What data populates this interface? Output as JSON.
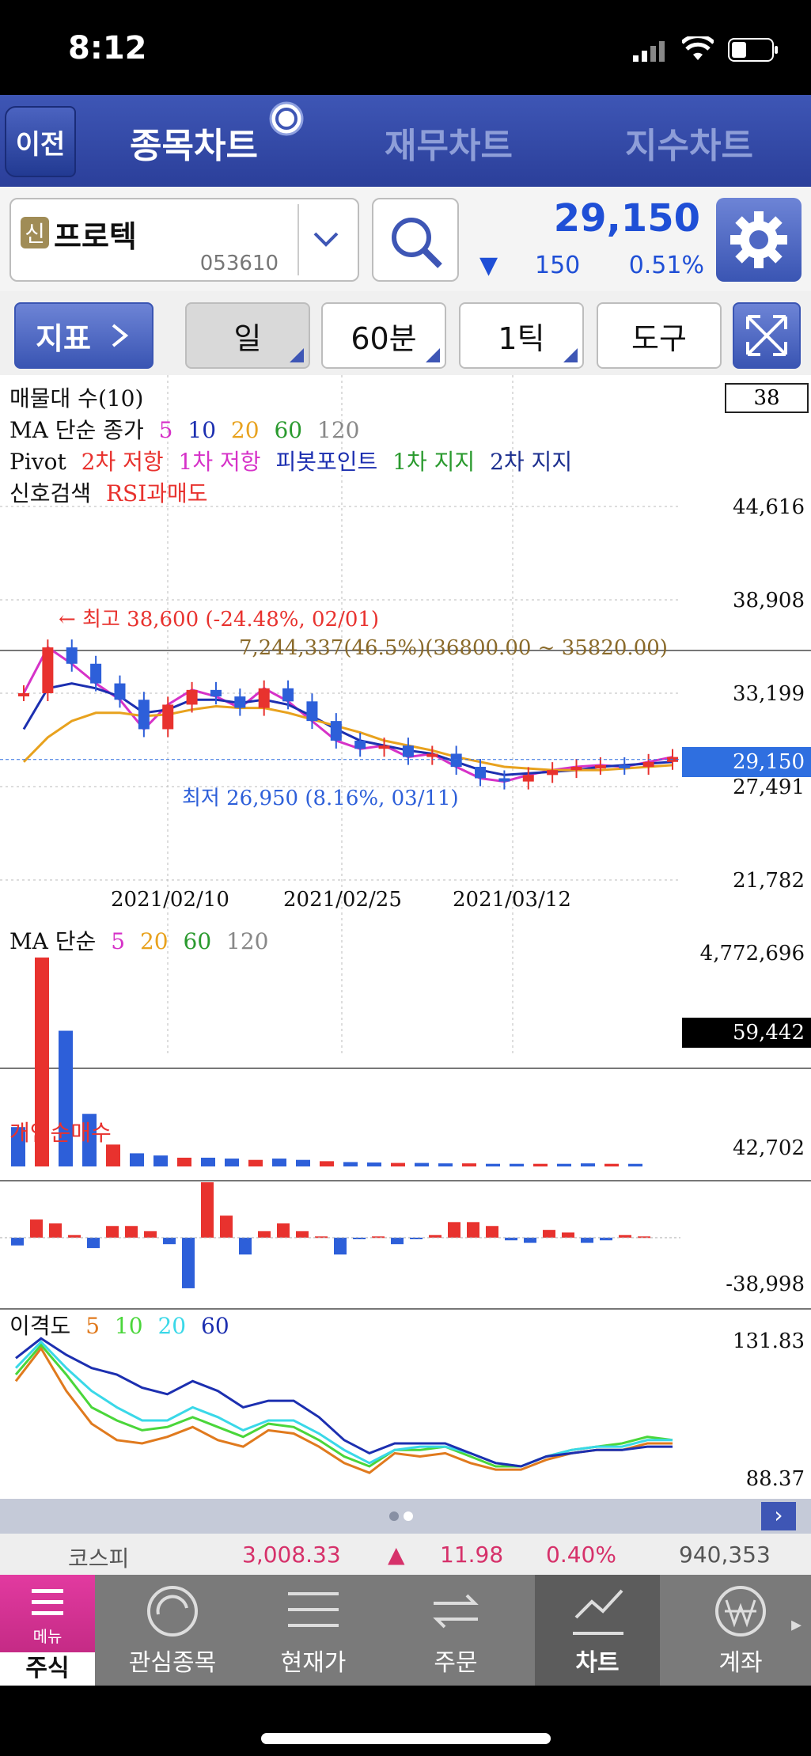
{
  "status_bar": {
    "time": "8:12"
  },
  "tabs": {
    "back": "이전",
    "items": [
      "종목차트",
      "재무차트",
      "지수차트"
    ]
  },
  "stock": {
    "badge": "신",
    "name": "프로텍",
    "code": "053610",
    "price": "29,150",
    "change_arrow": "▼",
    "change": "150",
    "change_pct": "0.51%"
  },
  "toolbar": {
    "indicator": "지표",
    "period": "일",
    "minute": "60분",
    "tick": "1틱",
    "tools": "도구"
  },
  "main_chart": {
    "legend": {
      "line1": "매물대 수(10)",
      "line2_prefix": "MA 단순 종가",
      "ma_periods": [
        "5",
        "10",
        "20",
        "60",
        "120"
      ],
      "line3_prefix": "Pivot",
      "pivot": [
        "2차 저항",
        "1차 저항",
        "피봇포인트",
        "1차 지지",
        "2차 지지"
      ],
      "line4_prefix": "신호검색",
      "signal": "RSI과매도"
    },
    "box_value": "38",
    "y_ticks": [
      "44,616",
      "38,908",
      "33,199",
      "27,491",
      "21,782"
    ],
    "current_price": "29,150",
    "high_annotation": "← 최고 38,600 (-24.48%, 02/01)",
    "low_annotation": "최저 26,950 (8.16%, 03/11)",
    "volume_profile_annotation": "7,244,337(46.5%)(36800.00 ~ 35820.00)",
    "x_ticks": [
      "2021/02/10",
      "2021/02/25",
      "2021/03/12"
    ]
  },
  "volume_chart": {
    "legend_prefix": "MA 단순",
    "ma_periods": [
      "5",
      "20",
      "60",
      "120"
    ],
    "y_top": "4,772,696",
    "current": "59,442"
  },
  "net_buy_chart": {
    "title": "개인순매수",
    "y_top": "42,702",
    "y_bottom": "-38,998"
  },
  "disparity_chart": {
    "title": "이격도",
    "periods": [
      "5",
      "10",
      "20",
      "60"
    ],
    "y_top": "131.83",
    "y_bottom": "88.37"
  },
  "index_ticker": {
    "name": "코스피",
    "value": "3,008.33",
    "arrow": "▲",
    "change": "11.98",
    "pct": "0.40%",
    "volume": "940,353"
  },
  "bottom_nav": {
    "menu": "메뉴",
    "items": [
      "주식",
      "관심종목",
      "현재가",
      "주문",
      "차트",
      "계좌"
    ]
  },
  "colors": {
    "up": "#e8322e",
    "down": "#2d5fd9",
    "ma5": "#d632c8",
    "ma10": "#1c2fb0",
    "ma20": "#e8a21e",
    "ma60": "#2a9a2e",
    "ma120": "#888888"
  },
  "chart_data": [
    {
      "type": "line",
      "title": "",
      "x_ticks": [
        "2021/02/10",
        "2021/02/25",
        "2021/03/12"
      ],
      "ylim": [
        21782,
        44616
      ],
      "series": [
        {
          "name": "5",
          "values": [
            33200,
            36000,
            35000,
            33800,
            32800,
            31000,
            32500,
            33400,
            33000,
            32300,
            33500,
            32700,
            31500,
            30300,
            29800,
            30000,
            29300,
            29500,
            28700,
            28000,
            27800,
            28200,
            28500,
            28700,
            28800,
            28700,
            29000,
            29300
          ]
        },
        {
          "name": "10",
          "values": [
            31000,
            33500,
            33800,
            33500,
            33000,
            32000,
            32200,
            32800,
            32800,
            32600,
            32800,
            32500,
            31800,
            31000,
            30300,
            30000,
            29700,
            29500,
            29000,
            28500,
            28200,
            28300,
            28400,
            28500,
            28700,
            28800,
            28900,
            29000
          ]
        },
        {
          "name": "20",
          "values": [
            29000,
            30500,
            31500,
            32000,
            32000,
            31800,
            31900,
            32200,
            32400,
            32300,
            32300,
            32000,
            31600,
            31200,
            30800,
            30300,
            30000,
            29700,
            29300,
            29000,
            28700,
            28600,
            28500,
            28500,
            28500,
            28600,
            28700,
            28800
          ]
        }
      ]
    },
    {
      "type": "bar",
      "title": "",
      "ylim": [
        0,
        4772696
      ],
      "values": [
        900000,
        4772696,
        3100000,
        1200000,
        500000,
        300000,
        250000,
        200000,
        200000,
        180000,
        150000,
        180000,
        150000,
        120000,
        100000,
        90000,
        80000,
        80000,
        70000,
        70000,
        60000,
        60000,
        60000,
        60000,
        70000,
        60000,
        59442
      ]
    },
    {
      "type": "bar",
      "title": "",
      "ylim": [
        -38998,
        42702
      ],
      "values": [
        -6000,
        14000,
        11000,
        2000,
        -8000,
        9000,
        9000,
        5000,
        -5000,
        -38998,
        42702,
        17000,
        -13000,
        5000,
        11000,
        5000,
        1000,
        -13000,
        -1000,
        1000,
        -5000,
        -1000,
        2000,
        12000,
        12000,
        9000,
        -2000,
        -4000,
        6000,
        4000,
        -4000,
        -2000,
        2000,
        1000
      ]
    },
    {
      "type": "line",
      "title": "",
      "ylim": [
        88.37,
        131.83
      ],
      "series": [
        {
          "name": "5",
          "values": [
            118,
            128,
            115,
            105,
            100,
            99,
            101,
            104,
            100,
            98,
            103,
            102,
            98,
            93,
            90,
            96,
            95,
            96,
            93,
            91,
            91,
            94,
            96,
            97,
            97,
            99,
            99
          ]
        },
        {
          "name": "10",
          "values": [
            120,
            129,
            120,
            110,
            106,
            103,
            104,
            107,
            104,
            101,
            105,
            104,
            100,
            95,
            92,
            97,
            97,
            98,
            95,
            92,
            92,
            95,
            97,
            98,
            99,
            101,
            100
          ]
        },
        {
          "name": "20",
          "values": [
            122,
            130,
            122,
            115,
            110,
            106,
            106,
            110,
            107,
            103,
            106,
            106,
            102,
            97,
            93,
            97,
            98,
            98,
            96,
            93,
            92,
            95,
            97,
            98,
            98,
            100,
            100
          ]
        },
        {
          "name": "60",
          "values": [
            125,
            131,
            126,
            122,
            120,
            116,
            114,
            118,
            115,
            110,
            112,
            112,
            107,
            100,
            96,
            99,
            99,
            99,
            96,
            93,
            92,
            95,
            96,
            97,
            97,
            98,
            98
          ]
        }
      ]
    }
  ]
}
